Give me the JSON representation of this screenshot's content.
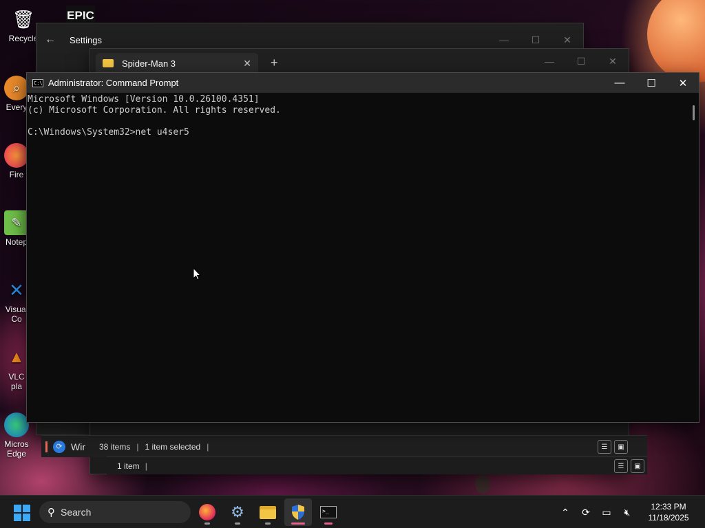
{
  "desktop": {
    "icons": [
      {
        "label": "Recycle",
        "icon": "recycle-bin-icon"
      },
      {
        "label": "Every",
        "icon": "everything-icon"
      },
      {
        "label": "Fire",
        "icon": "firefox-icon"
      },
      {
        "label": "Notep",
        "icon": "notepad-icon"
      },
      {
        "label": "Visual",
        "icon": "vscode-icon"
      },
      {
        "label": "Co",
        "icon": ""
      },
      {
        "label": "VLC",
        "icon": "vlc-icon"
      },
      {
        "label": "pla",
        "icon": ""
      },
      {
        "label": "Micros",
        "icon": "edge-icon"
      },
      {
        "label": "Edge",
        "icon": ""
      }
    ],
    "epic_label": "EPIC"
  },
  "settings": {
    "title": "Settings"
  },
  "explorer": {
    "tab_title": "Spider-Man 3",
    "status_items": "38 items",
    "status_selected": "1 item selected"
  },
  "explorer2": {
    "sidebar_label": "Wir",
    "status": "1 item"
  },
  "cmd": {
    "title": "Administrator: Command Prompt",
    "lines": [
      "Microsoft Windows [Version 10.0.26100.4351]",
      "(c) Microsoft Corporation. All rights reserved.",
      "",
      "C:\\Windows\\System32>net u4ser5"
    ]
  },
  "taskbar": {
    "search_placeholder": "Search",
    "time": "12:33 PM",
    "date": "11/18/2025"
  },
  "colors": {
    "accent": "#3fa8f4",
    "cmd_bg": "#0c0c0c",
    "taskbar_bg": "#1c1c1c",
    "active_indicator": "#e8638a"
  }
}
